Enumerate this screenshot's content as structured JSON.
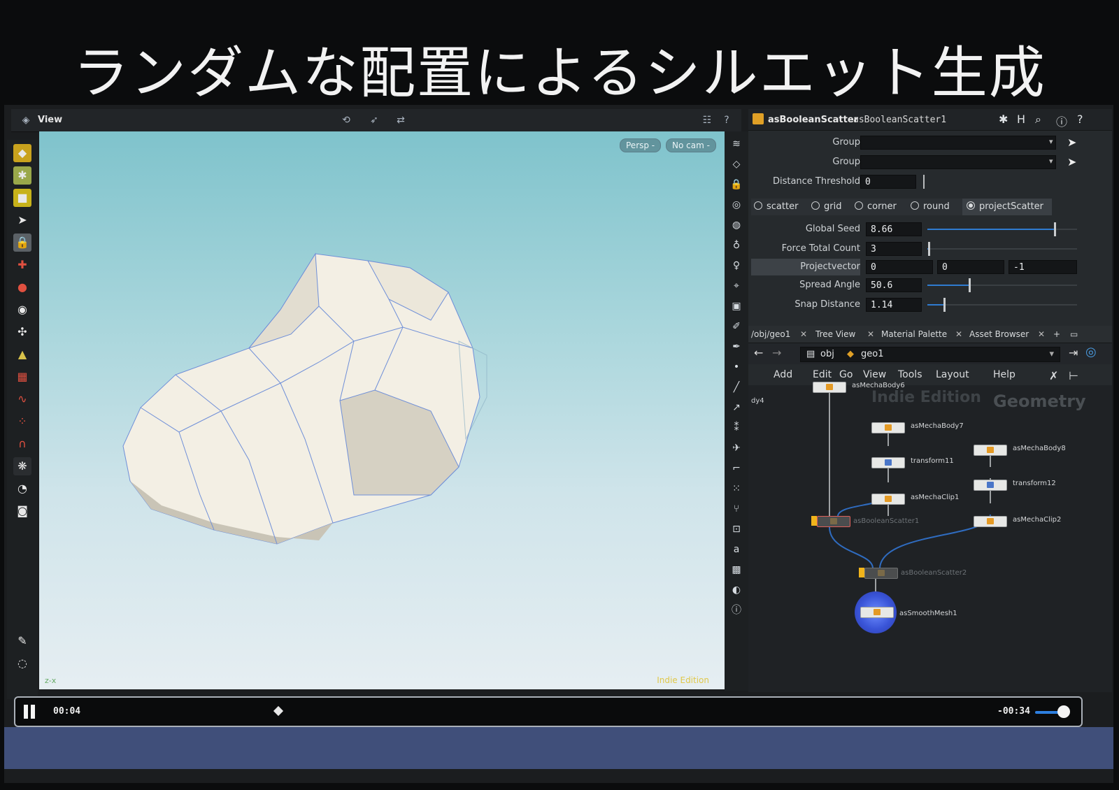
{
  "slide": {
    "title": "ランダムな配置によるシルエット生成"
  },
  "viewport": {
    "label": "View",
    "camera_persp": "Persp -",
    "camera_cam": "No cam -",
    "indie_mark": "Indie Edition",
    "axis_label": "z-x"
  },
  "params": {
    "node_type": "asBooleanScatter",
    "node_name": "asBooleanScatter1",
    "group1_label": "Group",
    "group2_label": "Group",
    "distance_threshold_label": "Distance Threshold",
    "distance_threshold_value": "0",
    "tabs": [
      "scatter",
      "grid",
      "corner",
      "round",
      "projectScatter"
    ],
    "selected_tab": "projectScatter",
    "global_seed_label": "Global Seed",
    "global_seed_value": "8.66",
    "global_seed_fraction": 0.85,
    "force_total_count_label": "Force Total Count",
    "force_total_count_value": "3",
    "force_total_count_fraction": 0.01,
    "projectvector_label": "Projectvector",
    "projectvector_values": [
      "0",
      "0",
      "-1"
    ],
    "spread_angle_label": "Spread Angle",
    "spread_angle_value": "50.6",
    "spread_angle_fraction": 0.28,
    "snap_distance_label": "Snap Distance",
    "snap_distance_value": "1.14",
    "snap_distance_fraction": 0.11
  },
  "network": {
    "tabs": [
      "/obj/geo1",
      "Tree View",
      "Material Palette",
      "Asset Browser"
    ],
    "path_obj": "obj",
    "path_geo": "geo1",
    "menu": [
      "Add",
      "Edit",
      "Go",
      "View",
      "Tools",
      "Layout",
      "Help"
    ],
    "watermark_edition": "Indie Edition",
    "watermark_context": "Geometry",
    "side_label": "dy4",
    "nodes": {
      "asMechaBody6": "asMechaBody6",
      "asMechaBody7": "asMechaBody7",
      "transform11": "transform11",
      "asMechaClip1": "asMechaClip1",
      "asMechaBody8": "asMechaBody8",
      "transform12": "transform12",
      "asMechaClip2": "asMechaClip2",
      "asBooleanScatter1": "asBooleanScatter1",
      "asBooleanScatter2": "asBooleanScatter2",
      "asSmoothMesh1": "asSmoothMesh1"
    }
  },
  "player": {
    "elapsed": "00:04",
    "remaining": "-00:34",
    "progress_fraction": 0.18,
    "volume_fraction": 0.75
  },
  "colors": {
    "accent": "#2f7bd0",
    "node_icon": "#e49a25",
    "flag": "#f1b41b"
  }
}
